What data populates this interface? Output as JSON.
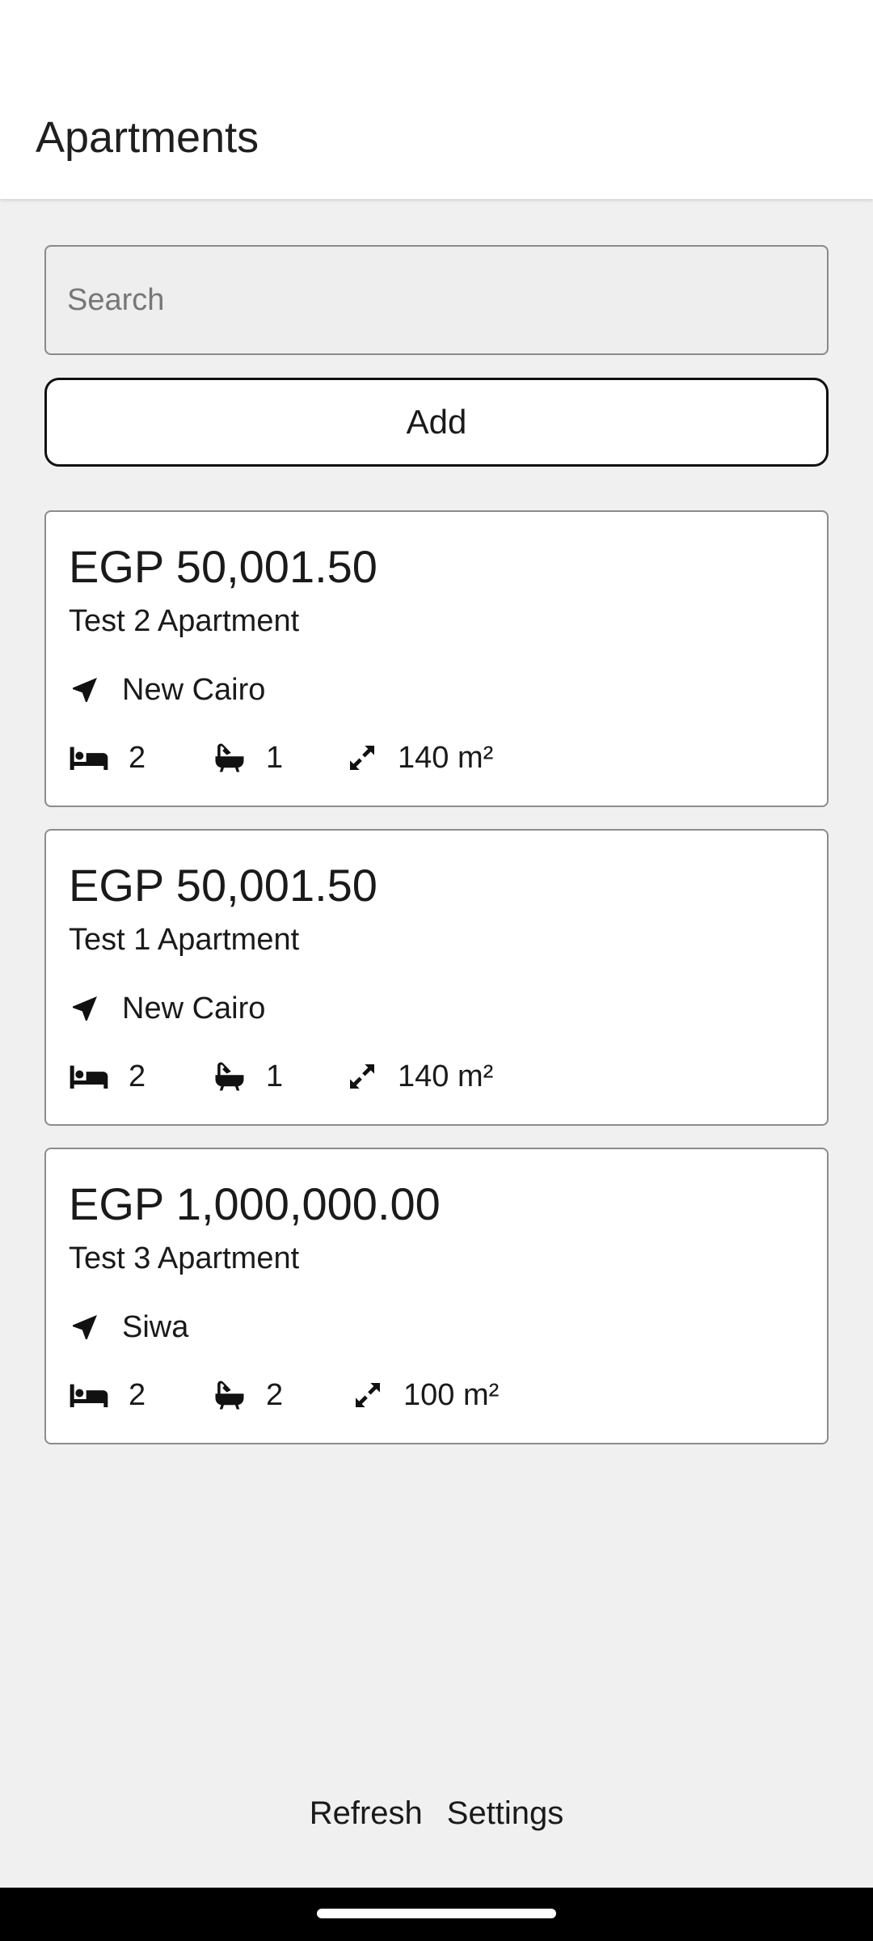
{
  "app_bar": {
    "title": "Apartments"
  },
  "search": {
    "placeholder": "Search",
    "value": ""
  },
  "add_button": {
    "label": "Add"
  },
  "apartments": [
    {
      "price": "EGP 50,001.50",
      "name": "Test 2 Apartment",
      "location": "New Cairo",
      "beds": "2",
      "baths": "1",
      "area": "140 m²"
    },
    {
      "price": "EGP 50,001.50",
      "name": "Test 1 Apartment",
      "location": "New Cairo",
      "beds": "2",
      "baths": "1",
      "area": "140 m²"
    },
    {
      "price": "EGP 1,000,000.00",
      "name": "Test 3 Apartment",
      "location": "Siwa",
      "beds": "2",
      "baths": "2",
      "area": "100 m²"
    }
  ],
  "footer": {
    "refresh_label": "Refresh",
    "settings_label": "Settings"
  },
  "icons": {
    "location": "navigation-arrow-icon",
    "beds": "bed-icon",
    "baths": "bathtub-icon",
    "area": "expand-arrows-icon"
  },
  "colors": {
    "background": "#f0f0f0",
    "card": "#ffffff",
    "card_border": "#8c8c8c",
    "text": "#1a1a1a"
  }
}
